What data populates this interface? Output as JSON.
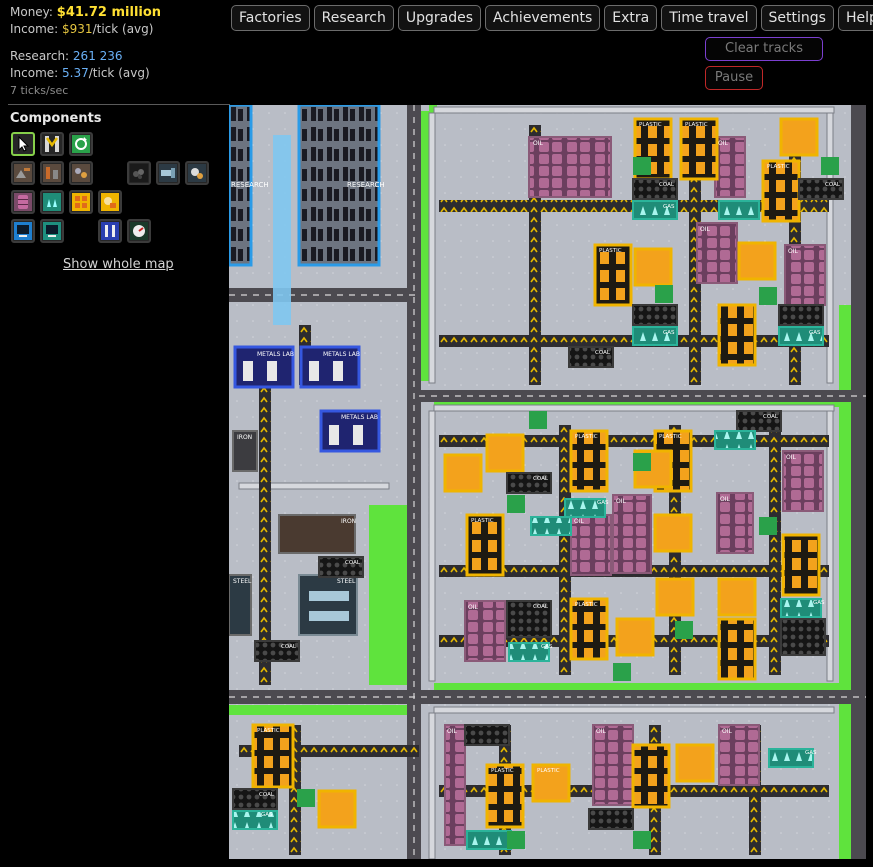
{
  "stats": {
    "money_label": "Money:",
    "money_value": "$41.72 million",
    "income_label": "Income:",
    "income_value": "$931",
    "income_suffix": "/tick (avg)",
    "research_label": "Research:",
    "research_value": "261 236",
    "research_income_label": "Income:",
    "research_income_value": "5.37",
    "research_income_suffix": "/tick (avg)",
    "ticks": "7 ticks/sec"
  },
  "nav": {
    "factories": "Factories",
    "research": "Research",
    "upgrades": "Upgrades",
    "achievements": "Achievements",
    "extra": "Extra",
    "time_travel": "Time travel",
    "settings": "Settings",
    "help": "Help"
  },
  "controls": {
    "clear_tracks": "Clear tracks",
    "pause": "Pause"
  },
  "components": {
    "title": "Components",
    "show_whole_map": "Show whole map"
  },
  "map_labels": {
    "oil": "OIL",
    "plastic": "PLASTIC",
    "coal": "COAL",
    "gas": "GAS",
    "research": "RESEARCH",
    "metals_lab": "METALS LAB",
    "iron": "IRON",
    "steel": "STEEL"
  },
  "colors": {
    "money": "#ffe033",
    "research": "#6ab0f5",
    "selected_tool": "#86d04a",
    "clear_tracks_border": "#7b3fd0",
    "pause_border": "#c02828",
    "plastic_frame": "#f0b400",
    "oil_frame": "#8a5a78",
    "gas_frame": "#2bb39a",
    "lab_frame": "#3557e0",
    "research_frame": "#2a9be8",
    "grass": "#5fe33d",
    "road": "#4c4a50",
    "floor": "#b9bdc6"
  }
}
